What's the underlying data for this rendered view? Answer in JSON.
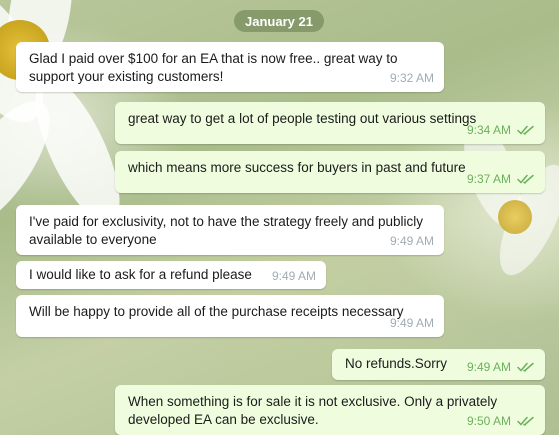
{
  "chat": {
    "date": "January 21",
    "messages": [
      {
        "dir": "in",
        "lines": [
          "Glad I paid over $100 for an EA that is now free.. great way to",
          "support your existing customers!"
        ],
        "time": "9:32 AM"
      },
      {
        "dir": "out",
        "lines": [
          "great way to get a lot of people testing out various settings"
        ],
        "time": "9:34 AM",
        "read": true
      },
      {
        "dir": "out",
        "lines": [
          "which means more success for buyers in past and future"
        ],
        "time": "9:37 AM",
        "read": true
      },
      {
        "dir": "in",
        "lines": [
          "I've paid for exclusivity, not to have the strategy freely and publicly",
          "available to everyone"
        ],
        "time": "9:49 AM"
      },
      {
        "dir": "in",
        "lines": [
          "I would like to ask for a refund please"
        ],
        "time": "9:49 AM"
      },
      {
        "dir": "in",
        "lines": [
          "Will be happy to provide all of the purchase receipts necessary"
        ],
        "time": "9:49 AM"
      },
      {
        "dir": "out",
        "lines": [
          "No refunds.Sorry"
        ],
        "time": "9:49 AM",
        "read": true
      },
      {
        "dir": "out",
        "lines": [
          "When something is for sale it is not exclusive. Only a privately",
          "developed EA can be exclusive."
        ],
        "time": "9:50 AM",
        "read": true
      }
    ]
  },
  "colors": {
    "incoming_bubble": "#ffffff",
    "outgoing_bubble": "#effdde",
    "read_check": "#6cb05b",
    "date_pill": "#7a8c5f"
  },
  "icons": {
    "read_receipt": "double-check-icon"
  }
}
